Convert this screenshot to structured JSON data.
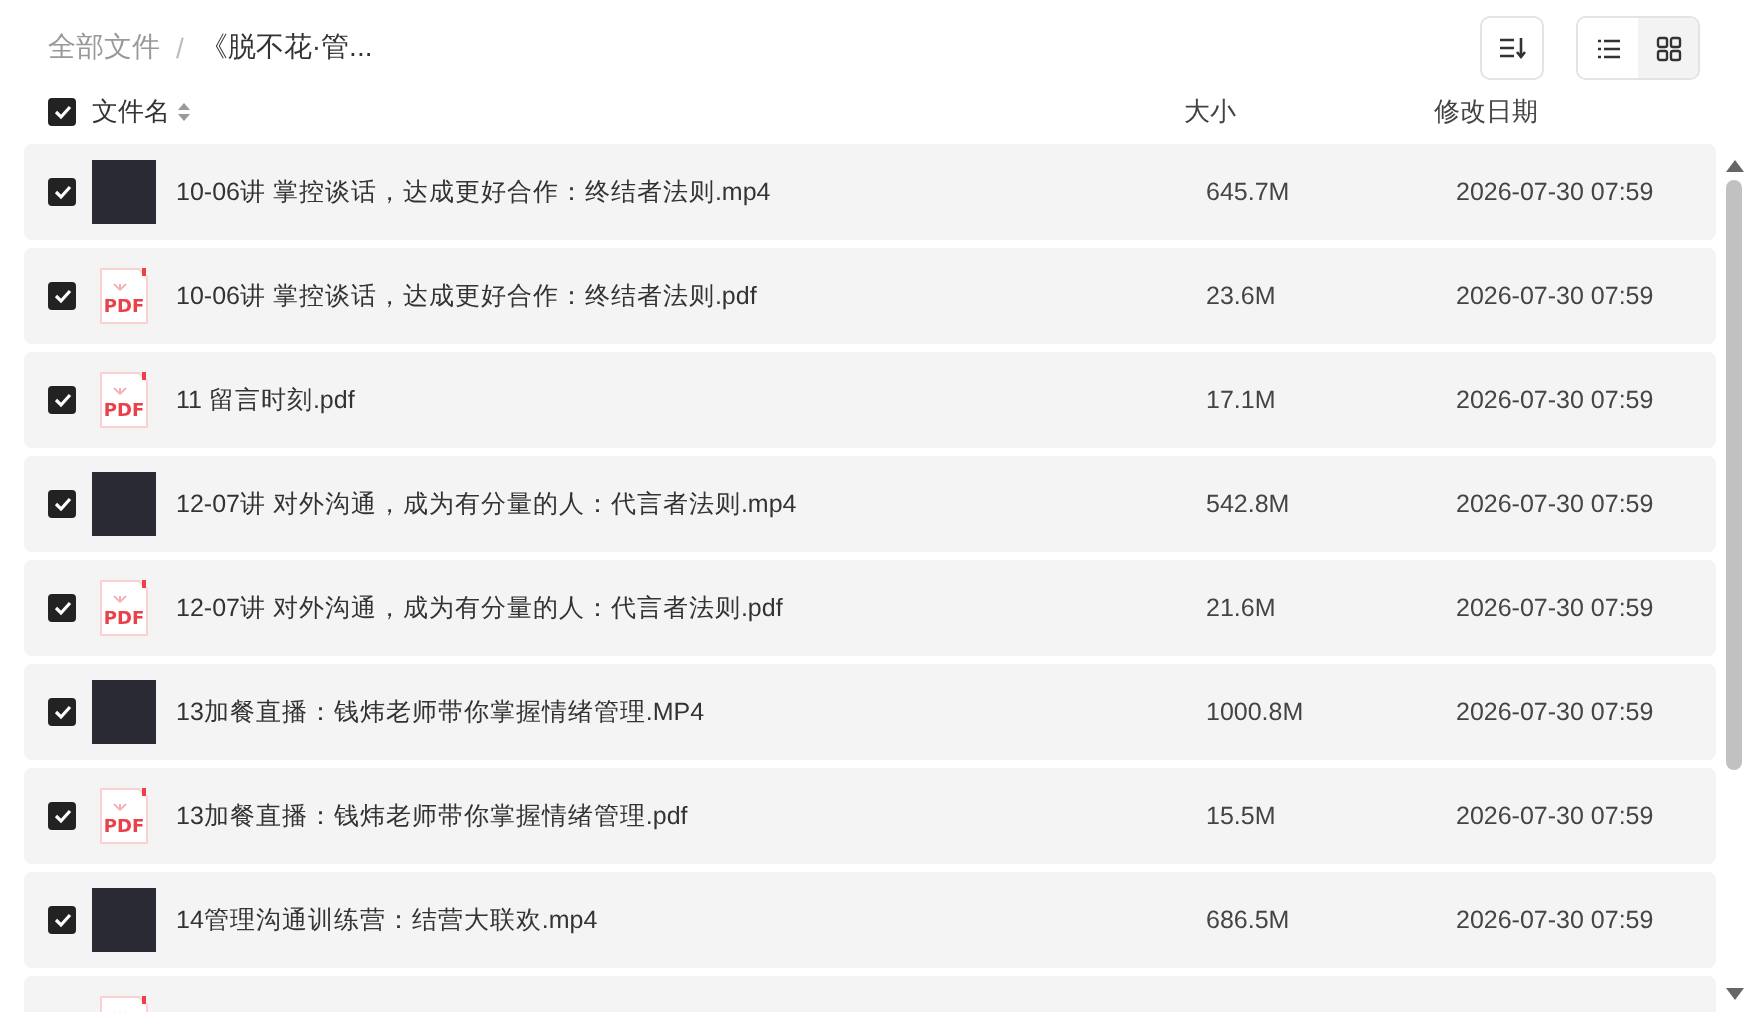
{
  "breadcrumb": [
    {
      "label": "全部文件",
      "current": false
    },
    {
      "label": "《脱不花·管...",
      "current": true
    }
  ],
  "breadcrumb_separator": "/",
  "view_mode": {
    "list_selected": true
  },
  "header": {
    "checked": true,
    "columns": [
      "文件名",
      "大小",
      "修改日期"
    ]
  },
  "rows": [
    {
      "kind": "video",
      "checked": true,
      "name": "10-06讲 掌控谈话，达成更好合作：终结者法则.mp4",
      "size": "645.7M",
      "date": "2026-07-30 07:59"
    },
    {
      "kind": "pdf",
      "icon_label": "PDF",
      "checked": true,
      "name": "10-06讲 掌控谈话，达成更好合作：终结者法则.pdf",
      "size": "23.6M",
      "date": "2026-07-30 07:59"
    },
    {
      "kind": "pdf",
      "icon_label": "PDF",
      "checked": true,
      "name": "11 留言时刻.pdf",
      "size": "17.1M",
      "date": "2026-07-30 07:59"
    },
    {
      "kind": "video",
      "checked": true,
      "name": "12-07讲 对外沟通，成为有分量的人：代言者法则.mp4",
      "size": "542.8M",
      "date": "2026-07-30 07:59"
    },
    {
      "kind": "pdf",
      "icon_label": "PDF",
      "checked": true,
      "name": "12-07讲 对外沟通，成为有分量的人：代言者法则.pdf",
      "size": "21.6M",
      "date": "2026-07-30 07:59"
    },
    {
      "kind": "video",
      "checked": true,
      "name": "13加餐直播：钱炜老师带你掌握情绪管理.MP4",
      "size": "1000.8M",
      "date": "2026-07-30 07:59"
    },
    {
      "kind": "pdf",
      "icon_label": "PDF",
      "checked": true,
      "name": "13加餐直播：钱炜老师带你掌握情绪管理.pdf",
      "size": "15.5M",
      "date": "2026-07-30 07:59"
    },
    {
      "kind": "video",
      "checked": true,
      "name": "14管理沟通训练营：结营大联欢.mp4",
      "size": "686.5M",
      "date": "2026-07-30 07:59"
    },
    {
      "kind": "pdf"
    }
  ]
}
